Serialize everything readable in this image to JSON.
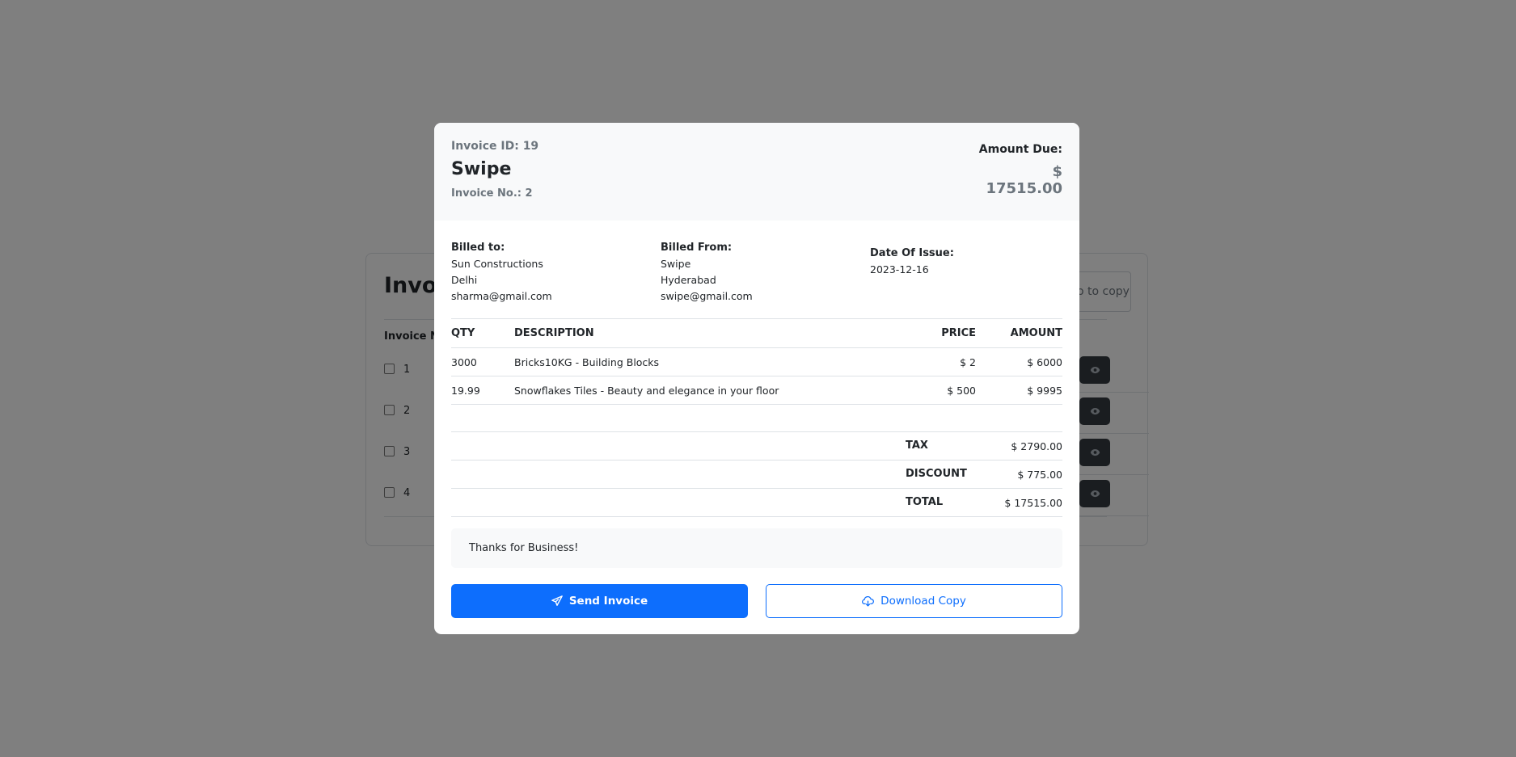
{
  "background": {
    "title": "Invoice",
    "column_header": "Invoice No.",
    "copy_field_text": "o to copy",
    "rows": [
      {
        "num": "1"
      },
      {
        "num": "2"
      },
      {
        "num": "3"
      },
      {
        "num": "4"
      }
    ]
  },
  "modal": {
    "invoice_id": "Invoice ID: 19",
    "company": "Swipe",
    "invoice_no": "Invoice No.: 2",
    "amount_due_label": "Amount Due:",
    "amount_due_currency": "$",
    "amount_due_value": "17515.00",
    "billed_to": {
      "label": "Billed to:",
      "name": "Sun Constructions",
      "city": "Delhi",
      "email": "sharma@gmail.com"
    },
    "billed_from": {
      "label": "Billed From:",
      "name": "Swipe",
      "city": "Hyderabad",
      "email": "swipe@gmail.com"
    },
    "date_of_issue": {
      "label": "Date Of Issue:",
      "value": "2023-12-16"
    },
    "table": {
      "headers": {
        "qty": "QTY",
        "description": "DESCRIPTION",
        "price": "PRICE",
        "amount": "AMOUNT"
      },
      "rows": [
        {
          "qty": "3000",
          "description": "Bricks10KG - Building Blocks",
          "price": "$ 2",
          "amount": "$ 6000"
        },
        {
          "qty": "19.99",
          "description": "Snowflakes Tiles - Beauty and elegance in your floor",
          "price": "$ 500",
          "amount": "$ 9995"
        }
      ]
    },
    "totals": {
      "tax_label": "TAX",
      "tax_value": "$ 2790.00",
      "discount_label": "DISCOUNT",
      "discount_value": "$ 775.00",
      "total_label": "TOTAL",
      "total_value": "$ 17515.00"
    },
    "notes": "Thanks for Business!",
    "send_button": "Send Invoice",
    "download_button": "Download Copy"
  },
  "colors": {
    "primary": "#0d6efd",
    "muted": "#6c757d",
    "header_bg": "#f8f9fa",
    "dark_button": "#343a40"
  }
}
